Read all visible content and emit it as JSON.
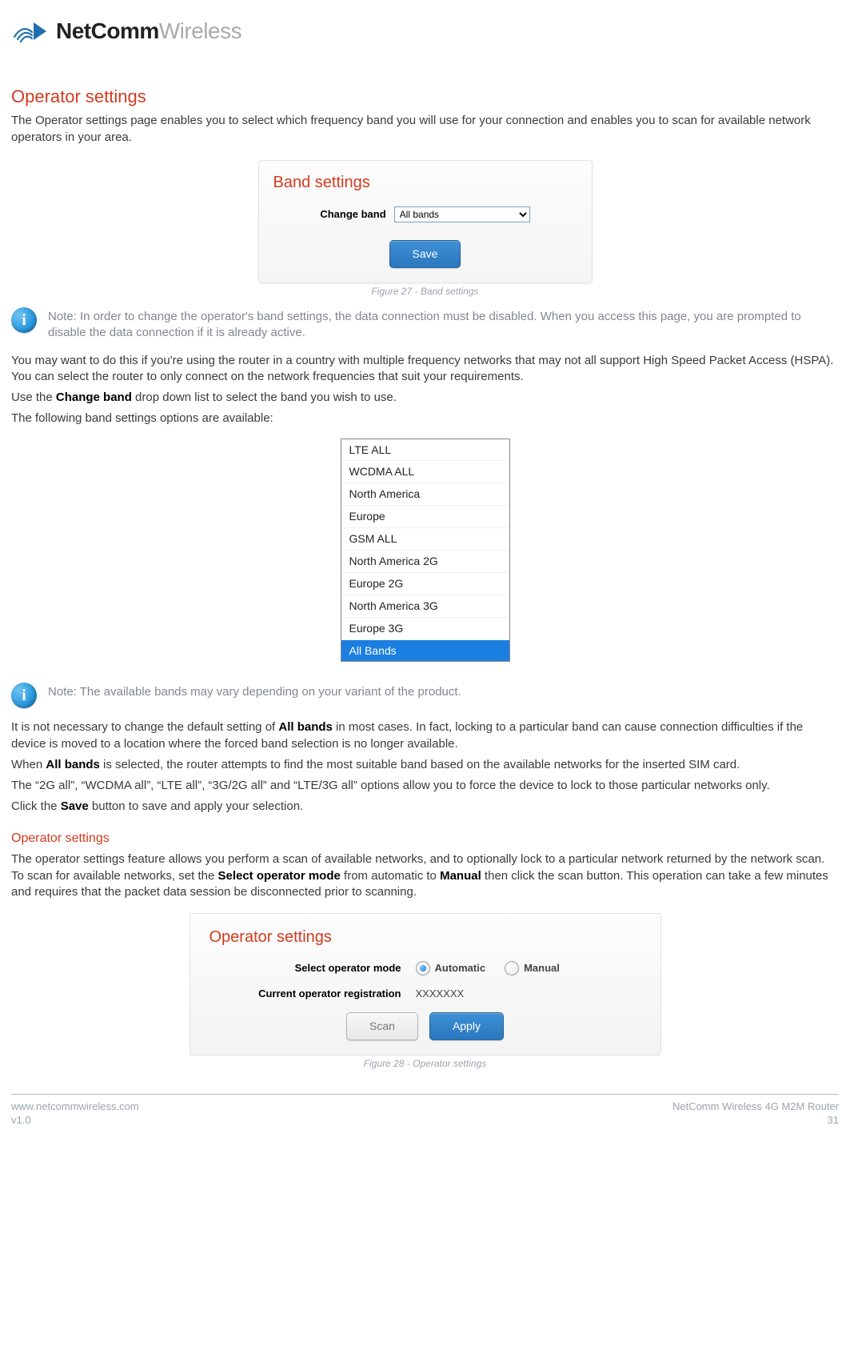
{
  "header": {
    "brand_bold": "NetComm",
    "brand_light": "Wireless"
  },
  "section1": {
    "title": "Operator settings",
    "intro": "The Operator settings page enables you to select which frequency band you will use for your connection and enables you to scan for available network operators in your area."
  },
  "band_panel": {
    "title": "Band settings",
    "label": "Change band",
    "selected": "All bands",
    "save": "Save"
  },
  "fig27": "Figure 27 - Band settings",
  "note1": "Note: In order to change the operator's band settings, the data connection must be disabled. When you access this page, you are prompted to disable the data connection if it is already active.",
  "para1": "You may want to do this if you're using the router in a country with multiple frequency networks that may not all support High Speed Packet Access (HSPA). You can select the router to only connect on the network frequencies that suit your requirements.",
  "para2a": "Use the ",
  "para2b": "Change band",
  "para2c": " drop down list to select the band you wish to use.",
  "para3": "The following band settings options are available:",
  "dropdown": {
    "options": [
      "LTE ALL",
      "WCDMA ALL",
      "North America",
      "Europe",
      "GSM ALL",
      "North America 2G",
      "Europe 2G",
      "North America 3G",
      "Europe 3G",
      "All Bands"
    ],
    "selected_index": 9
  },
  "note2": "Note: The available bands may vary depending on your variant of the product.",
  "para4a": "It is not necessary to change the default setting of ",
  "para4b": "All bands",
  "para4c": " in most cases. In fact, locking to a particular band can cause connection difficulties if the device is moved to a location where the forced band selection is no longer available.",
  "para5a": "When ",
  "para5b": "All bands",
  "para5c": " is selected, the router attempts to find the most suitable band based on the available networks for the inserted SIM card.",
  "para6": "The “2G all”, “WCDMA all”, “LTE all”, “3G/2G all” and “LTE/3G all” options allow you to force the device to lock to those particular networks only.",
  "para7a": "Click the ",
  "para7b": "Save",
  "para7c": " button to save and apply your selection.",
  "section2": {
    "title": "Operator settings",
    "body_a": "The operator settings feature allows you perform a scan of available networks, and to optionally lock to a particular network returned by the network scan. To scan for available networks, set the ",
    "body_b": "Select operator mode",
    "body_c": " from automatic to ",
    "body_d": "Manual",
    "body_e": " then click the scan button. This operation can take a few minutes and requires that the packet data session be disconnected prior to scanning."
  },
  "op_panel": {
    "title": "Operator settings",
    "mode_label": "Select operator mode",
    "opt_auto": "Automatic",
    "opt_manual": "Manual",
    "reg_label": "Current operator registration",
    "reg_value": "XXXXXXX",
    "scan": "Scan",
    "apply": "Apply"
  },
  "fig28": "Figure 28 - Operator settings",
  "footer": {
    "url": "www.netcommwireless.com",
    "ver": "v1.0",
    "product": "NetComm Wireless 4G M2M Router",
    "page": "31"
  }
}
